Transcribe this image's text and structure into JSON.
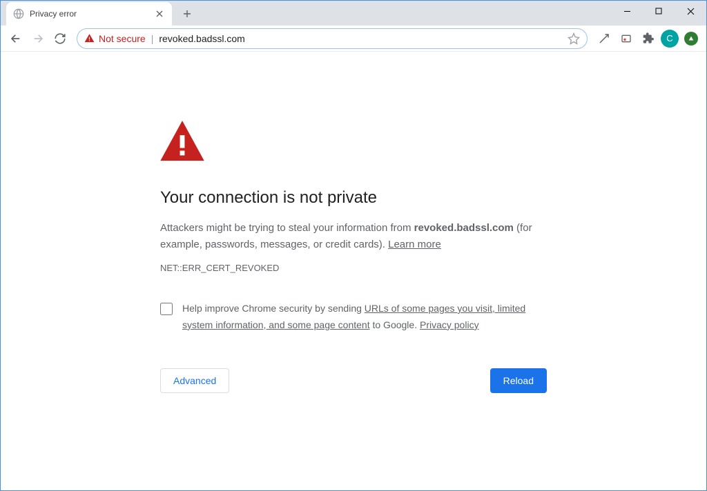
{
  "tab": {
    "title": "Privacy error"
  },
  "omnibox": {
    "security_label": "Not secure",
    "url": "revoked.badssl.com"
  },
  "avatar": {
    "letter": "C",
    "bg": "#00a3a3"
  },
  "menu_dot_bg": "#2e7d32",
  "page": {
    "heading": "Your connection is not private",
    "warn_prefix": "Attackers might be trying to steal your information from ",
    "warn_host": "revoked.badssl.com",
    "warn_suffix": " (for example, passwords, messages, or credit cards). ",
    "learn_more": "Learn more",
    "error_code": "NET::ERR_CERT_REVOKED",
    "optin_prefix": "Help improve Chrome security by sending ",
    "optin_link1": "URLs of some pages you visit, limited system information, and some page content",
    "optin_mid": " to Google. ",
    "optin_link2": "Privacy policy",
    "advanced": "Advanced",
    "reload": "Reload"
  }
}
